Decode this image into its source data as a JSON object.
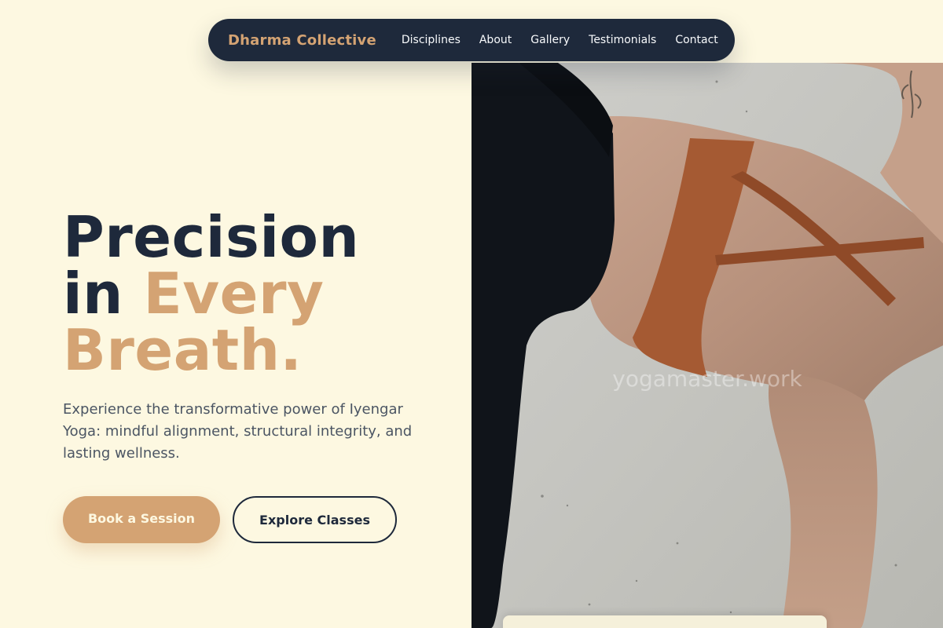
{
  "nav": {
    "brand": "Dharma Collective",
    "links": [
      {
        "label": "Disciplines"
      },
      {
        "label": "About"
      },
      {
        "label": "Gallery"
      },
      {
        "label": "Testimonials"
      },
      {
        "label": "Contact"
      }
    ]
  },
  "hero": {
    "headline_line1": "Precision",
    "headline_line2_prefix": "in ",
    "headline_line2_accent": "Every",
    "headline_line3_accent": "Breath.",
    "subtext": "Experience the transformative power of Iyengar Yoga: mindful alignment, structural integrity, and lasting wellness.",
    "primary_button": "Book a Session",
    "secondary_button": "Explore Classes",
    "image_watermark": "yogamaster.work"
  },
  "colors": {
    "background": "#fdf8e1",
    "navy": "#1e293b",
    "accent": "#d4a373",
    "body_text": "#4b5563"
  }
}
